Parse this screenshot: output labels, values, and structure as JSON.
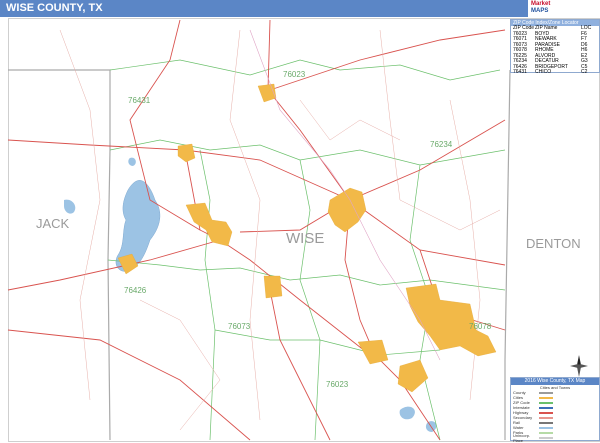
{
  "title": "WISE COUNTY, TX",
  "logo": {
    "line1": "Market",
    "line2": "MAPS"
  },
  "counties": {
    "main": "WISE",
    "west": "JACK",
    "east": "DENTON"
  },
  "zip_labels": {
    "z76023_north": "76023",
    "z76431": "76431",
    "z76234": "76234",
    "z76426": "76426",
    "z76073": "76073",
    "z76078": "76078",
    "z76023_south": "76023"
  },
  "zip_table": {
    "header": "ZIP Code Index/Zone Locator",
    "columns": [
      "ZIP Code",
      "ZIP Name",
      "LOC"
    ],
    "rows": [
      [
        "76023",
        "BOYD",
        "F6"
      ],
      [
        "76071",
        "NEWARK",
        "F7"
      ],
      [
        "76073",
        "PARADISE",
        "D6"
      ],
      [
        "76078",
        "RHOME",
        "H6"
      ],
      [
        "76225",
        "ALVORD",
        "E2"
      ],
      [
        "76234",
        "DECATUR",
        "G3"
      ],
      [
        "76426",
        "BRIDGEPORT",
        "C5"
      ],
      [
        "76431",
        "CHICO",
        "C2"
      ]
    ]
  },
  "legend": {
    "title": "2016 Wise County, TX Map",
    "subtitle": "Cities and Towns",
    "rows": [
      {
        "name": "County",
        "color": "#9b9b9b"
      },
      {
        "name": "Cities",
        "color": "#f2b948"
      },
      {
        "name": "ZIP Code",
        "color": "#6cc06c"
      },
      {
        "name": "Interstate",
        "color": "#3d6fb8"
      },
      {
        "name": "Highway",
        "color": "#d9534f"
      },
      {
        "name": "Secondary",
        "color": "#e7978f"
      },
      {
        "name": "Rail",
        "color": "#777777"
      },
      {
        "name": "Water",
        "color": "#9cc3e4"
      },
      {
        "name": "Parks",
        "color": "#b6dba6"
      },
      {
        "name": "Unincorp. Place",
        "color": "#cccccc"
      }
    ]
  },
  "colors": {
    "titlebar": "#5b86c6",
    "city": "#f2b948",
    "water": "#9cc3e4",
    "road": "#d9534f",
    "zip_boundary": "#6cc06c",
    "county_label": "#9a9a9a",
    "zip_label": "#6aaa6a"
  }
}
